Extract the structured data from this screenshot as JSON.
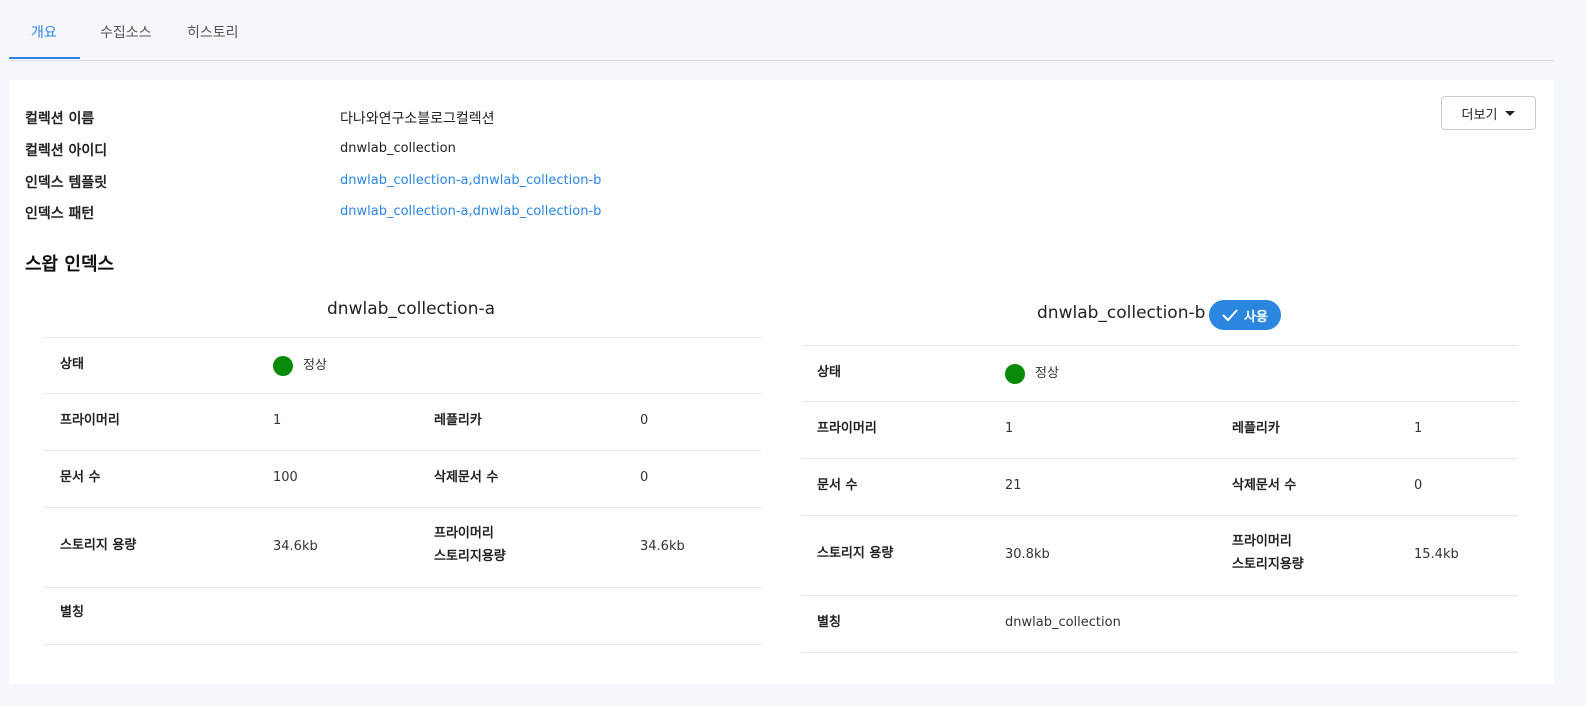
{
  "tabs": [
    {
      "label": "개요",
      "active": true
    },
    {
      "label": "수집소스",
      "active": false
    },
    {
      "label": "히스토리",
      "active": false
    }
  ],
  "more_button": {
    "label": "더보기"
  },
  "collection_info": {
    "name_label": "컬렉션 이름",
    "name_value": "다나와연구소블로그컬렉션",
    "id_label": "컬렉션 아이디",
    "id_value": "dnwlab_collection",
    "template_label": "인덱스 템플릿",
    "template_value": "dnwlab_collection-a,dnwlab_collection-b",
    "pattern_label": "인덱스 패턴",
    "pattern_value": "dnwlab_collection-a,dnwlab_collection-b"
  },
  "section_title": "스왑 인덱스",
  "colors": {
    "accent": "#2b86e0",
    "status_ok": "#0a8a0a"
  },
  "indices": [
    {
      "title": "dnwlab_collection-a",
      "badge": "",
      "status_label": "상태",
      "status_value": "정상",
      "primary_label": "프라이머리",
      "primary_value": "1",
      "replica_label": "레플리카",
      "replica_value": "0",
      "docs_label": "문서 수",
      "docs_value": "100",
      "deleted_label": "삭제문서 수",
      "deleted_value": "0",
      "storage_label": "스토리지 용량",
      "storage_value": "34.6kb",
      "primary_storage_label_line1": "프라이머리",
      "primary_storage_label_line2": "스토리지용량",
      "primary_storage_value": "34.6kb",
      "alias_label": "별칭",
      "alias_value": ""
    },
    {
      "title": "dnwlab_collection-b",
      "badge": "사용",
      "status_label": "상태",
      "status_value": "정상",
      "primary_label": "프라이머리",
      "primary_value": "1",
      "replica_label": "레플리카",
      "replica_value": "1",
      "docs_label": "문서 수",
      "docs_value": "21",
      "deleted_label": "삭제문서 수",
      "deleted_value": "0",
      "storage_label": "스토리지 용량",
      "storage_value": "30.8kb",
      "primary_storage_label_line1": "프라이머리",
      "primary_storage_label_line2": "스토리지용량",
      "primary_storage_value": "15.4kb",
      "alias_label": "별칭",
      "alias_value": "dnwlab_collection"
    }
  ]
}
